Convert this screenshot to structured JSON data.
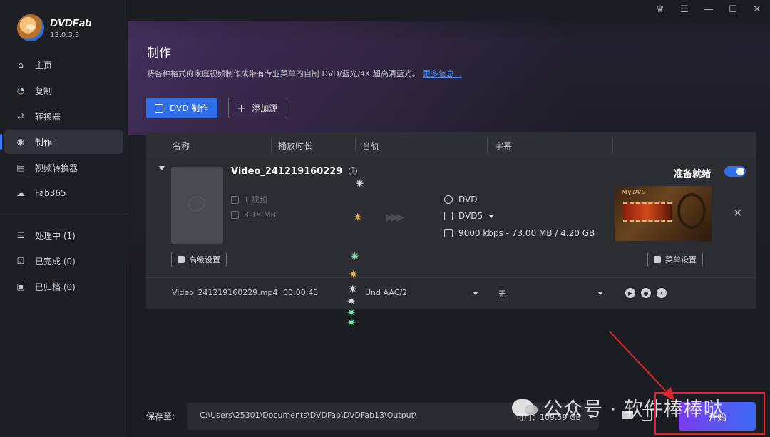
{
  "brand": {
    "name": "DVDFab",
    "version": "13.0.3.3"
  },
  "nav": {
    "items": [
      {
        "label": "主页",
        "icon": "home-icon"
      },
      {
        "label": "复制",
        "icon": "copy-icon"
      },
      {
        "label": "转换器",
        "icon": "converter-icon"
      },
      {
        "label": "制作",
        "icon": "disc-icon",
        "active": true
      },
      {
        "label": "视频转换器",
        "icon": "film-icon"
      },
      {
        "label": "Fab365",
        "icon": "cloud-icon"
      }
    ],
    "queue": [
      {
        "label": "处理中 (1)",
        "icon": "processing-icon"
      },
      {
        "label": "已完成 (0)",
        "icon": "completed-icon"
      },
      {
        "label": "已归档 (0)",
        "icon": "archive-icon"
      }
    ]
  },
  "header": {
    "title": "制作",
    "subtitle": "将各种格式的家庭视频制作成带有专业菜单的自制 DVD/蓝光/4K 超高清蓝光。",
    "more_link": "更多信息..."
  },
  "toolbar": {
    "dvd_create": "DVD 制作",
    "add_source": "添加源"
  },
  "table": {
    "columns": [
      "名称",
      "播放时长",
      "音轨",
      "字幕"
    ],
    "item": {
      "title": "Video_241219160229",
      "video_count": "1 视频",
      "size": "3.15 MB",
      "advanced_settings": "高级设置",
      "output_type": "DVD",
      "output_disc": "DVD5",
      "output_info": "9000 kbps - 73.00 MB / 4.20 GB",
      "status": "准备就绪",
      "menu_settings": "菜单设置",
      "menu_preview_title": "My DVD"
    },
    "sub_row": {
      "filename": "Video_241219160229.mp4",
      "duration": "00:00:43",
      "audio": "Und  AAC/2",
      "subtitle": "无"
    }
  },
  "footer": {
    "save_to_label": "保存至:",
    "path": "C:\\Users\\25301\\Documents\\DVDFab\\DVDFab13\\Output\\",
    "available": "可用：109.59 GB",
    "start": "开始"
  },
  "watermark": "公众号 · 软件棒棒哒",
  "colors": {
    "accent": "#2f6fe9",
    "start_gradient": [
      "#7b3cf0",
      "#3d6bf5"
    ],
    "annotation": "#e0232c"
  }
}
